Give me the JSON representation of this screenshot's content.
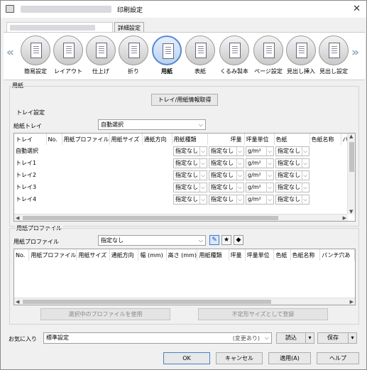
{
  "window": {
    "title": "印刷設定"
  },
  "tabs": {
    "detail": "詳細設定"
  },
  "nav": {
    "left_arrow": "«",
    "right_arrow": "»",
    "items": [
      {
        "label": "簡易設定"
      },
      {
        "label": "レイアウト"
      },
      {
        "label": "仕上げ"
      },
      {
        "label": "折り"
      },
      {
        "label": "用紙"
      },
      {
        "label": "表紙"
      },
      {
        "label": "くるみ製本"
      },
      {
        "label": "ページ設定"
      },
      {
        "label": "見出し挿入"
      },
      {
        "label": "見出し設定"
      }
    ]
  },
  "paper": {
    "section_title": "用紙",
    "get_info_button": "トレイ/用紙情報取得",
    "tray_group": "トレイ設定",
    "feed_tray_label": "給紙トレイ",
    "feed_tray_value": "自動選択",
    "tray_columns": [
      "トレイ",
      "No.",
      "用紙プロファイル",
      "用紙サイズ",
      "通紙方向",
      "用紙種類",
      "坪量",
      "坪量単位",
      "色紙",
      "色紙名称",
      "パ"
    ],
    "tray_rows": [
      {
        "tray": "自動選択",
        "type": "指定なし",
        "weight": "指定なし",
        "unit": "g/m²",
        "color": "指定なし"
      },
      {
        "tray": "トレイ1",
        "type": "指定なし",
        "weight": "指定なし",
        "unit": "g/m²",
        "color": "指定なし"
      },
      {
        "tray": "トレイ2",
        "type": "指定なし",
        "weight": "指定なし",
        "unit": "g/m²",
        "color": "指定なし"
      },
      {
        "tray": "トレイ3",
        "type": "指定なし",
        "weight": "指定なし",
        "unit": "g/m²",
        "color": "指定なし"
      },
      {
        "tray": "トレイ4",
        "type": "指定なし",
        "weight": "指定なし",
        "unit": "g/m²",
        "color": "指定なし"
      }
    ],
    "profile_group": "用紙プロファイル",
    "profile_label": "用紙プロファイル",
    "profile_value": "指定なし",
    "profile_columns": [
      "No.",
      "用紙プロファイル",
      "用紙サイズ",
      "通紙方向",
      "幅 (mm)",
      "高さ (mm)",
      "用紙種類",
      "坪量",
      "坪量単位",
      "色紙",
      "色紙名称",
      "パンチ穴あ"
    ],
    "use_selected_profile": "選択中のプロファイルを使用",
    "register_custom_size": "不定形サイズとして登録"
  },
  "favorites": {
    "label": "お気に入り",
    "value": "標準設定",
    "changed_note": "(変更あり)",
    "load": "読込",
    "save": "保存"
  },
  "footer": {
    "ok": "OK",
    "cancel": "キャンセル",
    "apply": "適用(A)",
    "help": "ヘルプ"
  },
  "icons": {
    "close": "✕",
    "chevron": "⌵",
    "star": "★"
  }
}
